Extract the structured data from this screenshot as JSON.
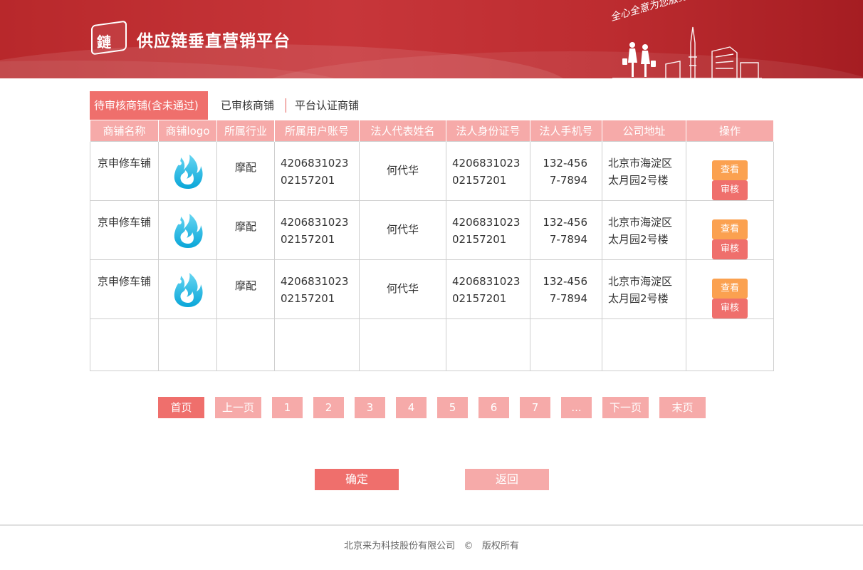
{
  "header": {
    "logo_glyph": "鏈",
    "title": "供应链垂直营销平台",
    "slogan": "全心全意为您服务!",
    "bg_color": "#bf2f33"
  },
  "tabs": [
    {
      "label": "待审核商铺(含未通过)",
      "active": true
    },
    {
      "label": "已审核商铺",
      "active": false
    },
    {
      "label": "平台认证商铺",
      "active": false
    }
  ],
  "table": {
    "headers": [
      "商铺名称",
      "商铺logo",
      "所属行业",
      "所属用户账号",
      "法人代表姓名",
      "法人身份证号",
      "法人手机号",
      "公司地址",
      "操作"
    ],
    "rows": [
      {
        "name": "京申修车铺",
        "logo_icon": "flame-logo-icon",
        "industry": "摩配",
        "account": "420683102302157201",
        "legal_name": "何代华",
        "id_number": "420683102302157201",
        "phone": "132-4567-7894",
        "address": "北京市海淀区太月园2号楼",
        "view_label": "查看",
        "review_label": "审核"
      },
      {
        "name": "京申修车铺",
        "logo_icon": "flame-logo-icon",
        "industry": "摩配",
        "account": "420683102302157201",
        "legal_name": "何代华",
        "id_number": "420683102302157201",
        "phone": "132-4567-7894",
        "address": "北京市海淀区太月园2号楼",
        "view_label": "查看",
        "review_label": "审核"
      },
      {
        "name": "京申修车铺",
        "logo_icon": "flame-logo-icon",
        "industry": "摩配",
        "account": "420683102302157201",
        "legal_name": "何代华",
        "id_number": "420683102302157201",
        "phone": "132-4567-7894",
        "address": "北京市海淀区太月园2号楼",
        "view_label": "查看",
        "review_label": "审核"
      }
    ]
  },
  "pagination": {
    "first": "首页",
    "prev": "上一页",
    "pages": [
      "1",
      "2",
      "3",
      "4",
      "5",
      "6",
      "7",
      "..."
    ],
    "next": "下一页",
    "last": "末页"
  },
  "actions": {
    "confirm": "确定",
    "back": "返回"
  },
  "footer": {
    "company": "北京来为科技股份有限公司",
    "copyright_symbol": "©",
    "rights": "版权所有"
  },
  "colors": {
    "accent": "#ef6f6c",
    "accent_light": "#f6aaa9",
    "view_button": "#fba150"
  }
}
